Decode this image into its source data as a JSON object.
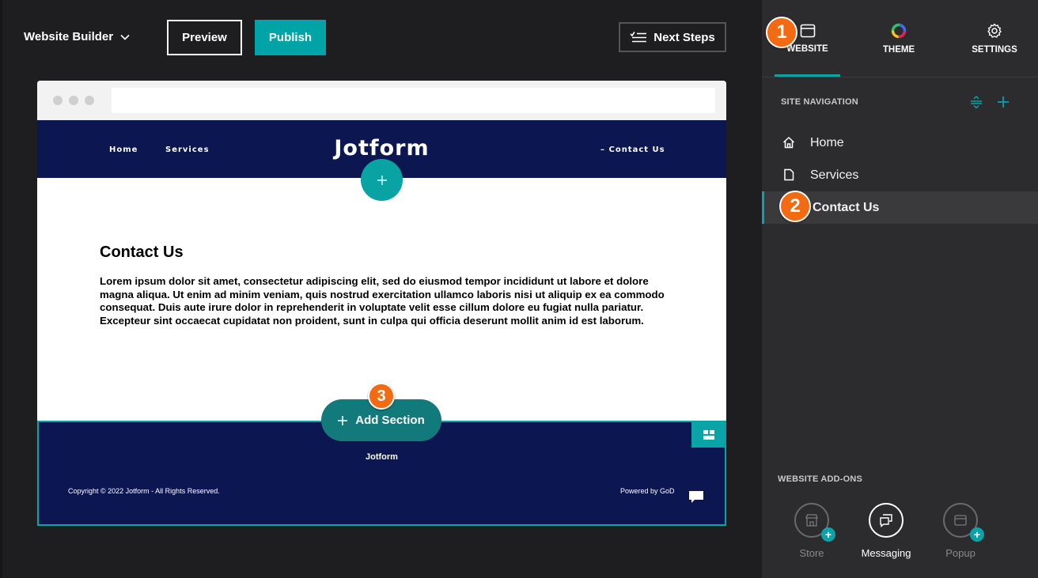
{
  "toolbar": {
    "brand_label": "Website Builder",
    "preview_label": "Preview",
    "publish_label": "Publish",
    "next_steps_label": "Next Steps"
  },
  "site": {
    "nav_home": "Home",
    "nav_services": "Services",
    "nav_contact": "– Contact Us",
    "logo": "Jotform",
    "page_title": "Contact Us",
    "page_body": "Lorem ipsum dolor sit amet, consectetur adipiscing elit, sed do eiusmod tempor incididunt ut labore et dolore magna aliqua. Ut enim ad minim veniam, quis nostrud exercitation ullamco laboris nisi ut aliquip ex ea commodo consequat. Duis aute irure dolor in reprehenderit in voluptate velit esse cillum dolore eu fugiat nulla pariatur. Excepteur sint occaecat cupidatat non proident, sunt in culpa qui officia deserunt mollit anim id est laborum.",
    "add_section_label": "Add Section",
    "footer_logo": "Jotform",
    "footer_copyright": "Copyright © 2022 Jotform - All Rights Reserved.",
    "footer_powered": "Powered by GoD"
  },
  "badges": {
    "one": "1",
    "two": "2",
    "three": "3"
  },
  "panel": {
    "tabs": [
      {
        "label": "WEBSITE",
        "icon": "browser-window-icon"
      },
      {
        "label": "THEME",
        "icon": "color-wheel-icon"
      },
      {
        "label": "SETTINGS",
        "icon": "gear-icon"
      }
    ],
    "site_navigation_label": "SITE NAVIGATION",
    "nav_items": [
      {
        "label": "Home",
        "icon": "home-icon"
      },
      {
        "label": "Services",
        "icon": "page-icon"
      },
      {
        "label": "Contact Us",
        "icon": "page-icon"
      }
    ],
    "addons_label": "WEBSITE ADD-ONS",
    "addons": [
      {
        "label": "Store",
        "icon": "store-icon"
      },
      {
        "label": "Messaging",
        "icon": "messaging-icon"
      },
      {
        "label": "Popup",
        "icon": "popup-icon"
      }
    ]
  },
  "colors": {
    "accent": "#00a4a6",
    "badge": "#f26a12",
    "site_navy": "#0c1650"
  }
}
